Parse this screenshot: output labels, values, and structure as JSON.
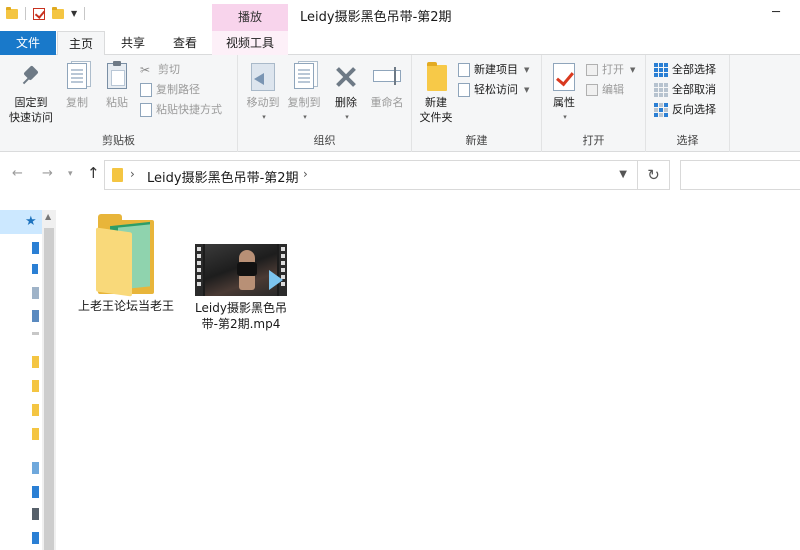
{
  "window": {
    "title": "Leidy摄影黑色吊带-第2期",
    "context_tab": "播放"
  },
  "tabs": {
    "file": "文件",
    "home": "主页",
    "share": "共享",
    "view": "查看",
    "video_tools": "视频工具"
  },
  "ribbon": {
    "clipboard": {
      "label": "剪贴板",
      "pin_line1": "固定到",
      "pin_line2": "快速访问",
      "copy": "复制",
      "paste": "粘贴",
      "cut": "剪切",
      "copy_path": "复制路径",
      "paste_shortcut": "粘贴快捷方式"
    },
    "organize": {
      "label": "组织",
      "move_to": "移动到",
      "copy_to": "复制到",
      "delete": "删除",
      "rename": "重命名"
    },
    "new": {
      "label": "新建",
      "new_folder_line1": "新建",
      "new_folder_line2": "文件夹",
      "new_item": "新建项目",
      "easy_access": "轻松访问"
    },
    "open": {
      "label": "打开",
      "properties": "属性",
      "open": "打开",
      "edit": "编辑"
    },
    "select": {
      "label": "选择",
      "select_all": "全部选择",
      "select_none": "全部取消",
      "invert": "反向选择"
    }
  },
  "address": {
    "path": "Leidy摄影黑色吊带-第2期"
  },
  "files": [
    {
      "name": "上老王论坛当老王",
      "type": "folder"
    },
    {
      "name": "Leidy摄影黑色吊带-第2期.mp4",
      "type": "video"
    }
  ],
  "colors": {
    "file_tab": "#1979ca",
    "context_tab": "#f8d4ec",
    "selection": "#cce8ff",
    "folder": "#f7c948"
  }
}
